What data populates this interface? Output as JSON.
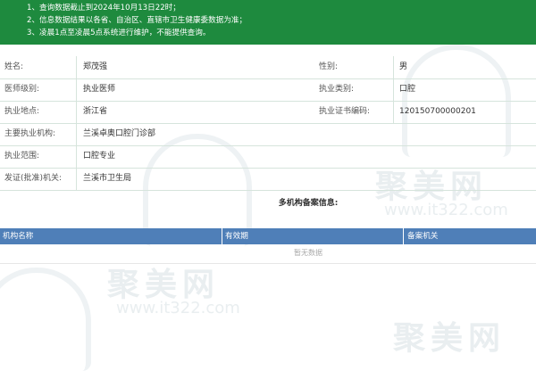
{
  "notice": {
    "lines": [
      "1、查询数据截止到2024年10月13日22时；",
      "2、信息数据结果以各省、自治区、直辖市卫生健康委数据为准；",
      "3、凌晨1点至凌晨5点系统进行维护，不能提供查询。"
    ]
  },
  "info": {
    "name_label": "姓名:",
    "name_value": "郑茂强",
    "gender_label": "性别:",
    "gender_value": "男",
    "level_label": "医师级别:",
    "level_value": "执业医师",
    "category_label": "执业类别:",
    "category_value": "口腔",
    "location_label": "执业地点:",
    "location_value": "浙江省",
    "cert_label": "执业证书编码:",
    "cert_value": "120150700000201",
    "institution_label": "主要执业机构:",
    "institution_value": "兰溪卓奥口腔门诊部",
    "scope_label": "执业范围:",
    "scope_value": "口腔专业",
    "issuer_label": "发证(批准)机关:",
    "issuer_value": "兰溪市卫生局"
  },
  "records": {
    "title": "多机构备案信息:",
    "columns": [
      "机构名称",
      "有效期",
      "备案机关"
    ],
    "empty_text": "暂无数据"
  },
  "watermark": {
    "brand": "聚美网",
    "url": "www.it322.com"
  },
  "colors": {
    "notice_bg": "#1e8a3e",
    "table_header_bg": "#4f7fb8",
    "row_border": "#d6e4dc"
  }
}
